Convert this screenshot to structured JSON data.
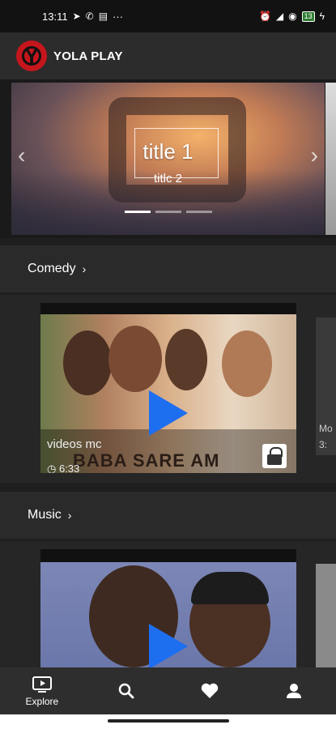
{
  "status_bar": {
    "time": "13:11",
    "notification_icons": [
      "telegram-icon",
      "whatsapp-icon",
      "news-icon"
    ],
    "more": "···",
    "battery_level": "13"
  },
  "header": {
    "app_name": "YOLA PLAY",
    "logo_letter": "Y"
  },
  "hero": {
    "title": "title 1",
    "subtitle": "titlc 2",
    "prev_arrow": "‹",
    "next_arrow": "›",
    "slide_count": 3,
    "active_slide": 1
  },
  "sections": [
    {
      "name": "Comedy",
      "chevron": "›",
      "cards": [
        {
          "channel": "videos mc",
          "duration": "6:33",
          "caption": "BABA SARE AM",
          "locked": true
        }
      ],
      "peek_caption": "Mo",
      "peek_duration": "3:"
    },
    {
      "name": "Music",
      "chevron": "›",
      "cards": [
        {
          "channel": "",
          "duration": "",
          "caption": "",
          "locked": false
        }
      ]
    }
  ],
  "bottom_nav": {
    "items": [
      {
        "label": "Explore",
        "icon": "tv-play-icon",
        "active": true
      },
      {
        "label": "",
        "icon": "search-icon"
      },
      {
        "label": "",
        "icon": "heart-icon"
      },
      {
        "label": "",
        "icon": "person-icon"
      }
    ]
  },
  "colors": {
    "accent_play": "#1e6ef0",
    "brand_red": "#c4161c",
    "background": "#1f1f1f"
  }
}
